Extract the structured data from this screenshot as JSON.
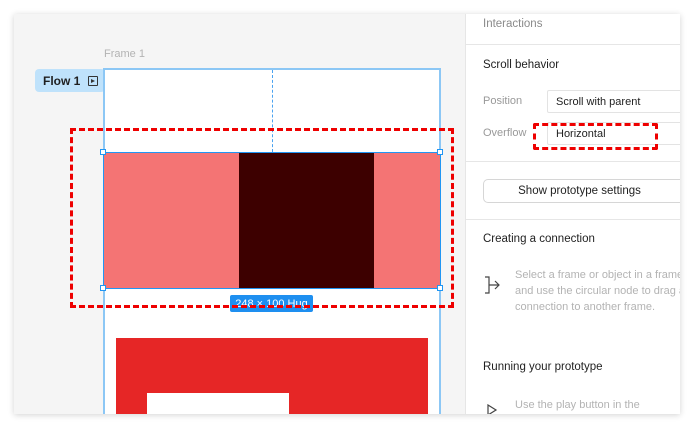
{
  "canvas": {
    "frame_label": "Frame 1",
    "flow_label": "Flow 1",
    "size_badge": "248 × 100 Hug",
    "colors": {
      "canvas_bg": "#f5f5f5",
      "selection": "#2196f3",
      "block_light": "#f47474",
      "block_dark": "#3d0000",
      "red_block": "#e62626",
      "highlight": "#ee0000"
    }
  },
  "panel": {
    "interactions_title": "Interactions",
    "scroll_behavior_title": "Scroll behavior",
    "position_label": "Position",
    "position_value": "Scroll with parent",
    "overflow_label": "Overflow",
    "overflow_value": "Horizontal",
    "show_settings_button": "Show prototype settings",
    "creating_connection_title": "Creating a connection",
    "creating_connection_text": "Select a frame or object in a frame and use the circular node to drag a connection to another frame.",
    "running_prototype_title": "Running your prototype",
    "running_prototype_text": "Use the play button in the"
  }
}
